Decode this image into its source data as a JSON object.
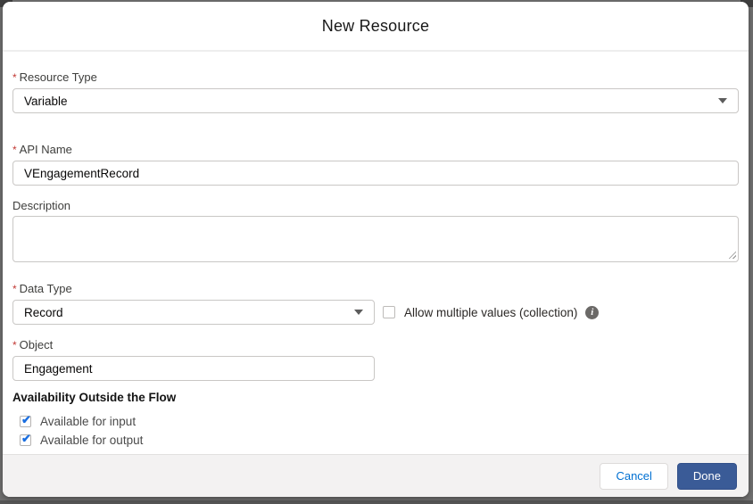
{
  "dialog": {
    "title": "New Resource",
    "required_marker": "*",
    "icons": {
      "check": "✔",
      "info": "i"
    },
    "fields": {
      "resource_type": {
        "label": "Resource Type",
        "required": true,
        "value": "Variable"
      },
      "api_name": {
        "label": "API Name",
        "required": true,
        "value": "VEngagementRecord"
      },
      "description": {
        "label": "Description",
        "value": ""
      },
      "data_type": {
        "label": "Data Type",
        "required": true,
        "value": "Record"
      },
      "allow_multiple": {
        "label": "Allow multiple values (collection)",
        "checked": false
      },
      "object": {
        "label": "Object",
        "required": true,
        "value": "Engagement"
      }
    },
    "availability": {
      "heading": "Availability Outside the Flow",
      "options": [
        {
          "label": "Available for input",
          "checked": true
        },
        {
          "label": "Available for output",
          "checked": true
        }
      ]
    },
    "footer": {
      "cancel_label": "Cancel",
      "done_label": "Done"
    },
    "colors": {
      "required_asterisk": "#c23934",
      "cancel_text": "#0070d2",
      "done_button_bg": "#3a5b97",
      "checkmark_blue": "#1a6ee0",
      "footer_bg": "#f3f2f2",
      "backdrop": "#6f6f6f"
    }
  }
}
